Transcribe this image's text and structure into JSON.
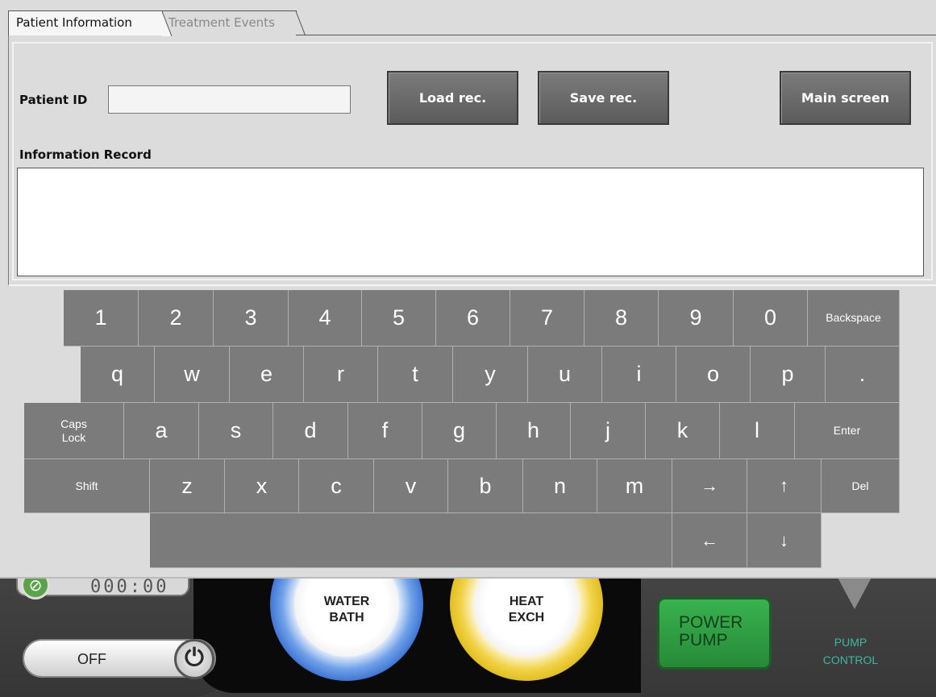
{
  "tabs": [
    {
      "label": "Patient Information",
      "active": true
    },
    {
      "label": "Treatment Events",
      "active": false
    }
  ],
  "form": {
    "patient_id_label": "Patient ID",
    "patient_id_value": "",
    "info_record_label": "Information Record",
    "info_record_value": ""
  },
  "buttons": {
    "load": "Load rec.",
    "save": "Save rec.",
    "main": "Main screen"
  },
  "keyboard": {
    "row1": [
      "1",
      "2",
      "3",
      "4",
      "5",
      "6",
      "7",
      "8",
      "9",
      "0",
      "Backspace"
    ],
    "row2": [
      "q",
      "w",
      "e",
      "r",
      "t",
      "y",
      "u",
      "i",
      "o",
      "p",
      "."
    ],
    "row3": [
      "Caps\nLock",
      "a",
      "s",
      "d",
      "f",
      "g",
      "h",
      "j",
      "k",
      "l",
      "Enter"
    ],
    "row4": [
      "Shift",
      "z",
      "x",
      "c",
      "v",
      "b",
      "n",
      "m",
      "→",
      "↑",
      "Del"
    ],
    "row5": [
      "",
      "←",
      "↓"
    ]
  },
  "device": {
    "timer": "000:00",
    "off_label": "OFF",
    "water_bath": [
      "WATER",
      "BATH"
    ],
    "heat_exch": [
      "HEAT",
      "EXCH"
    ],
    "power_pump": [
      "POWER",
      "PUMP"
    ],
    "pump_control": [
      "PUMP",
      "CONTROL"
    ]
  },
  "colors": {
    "key_bg": "#7b7b7b",
    "window_bg": "#dcdcdc",
    "pump_green": "#2e9e44",
    "pump_control_text": "#3eb7a1"
  }
}
